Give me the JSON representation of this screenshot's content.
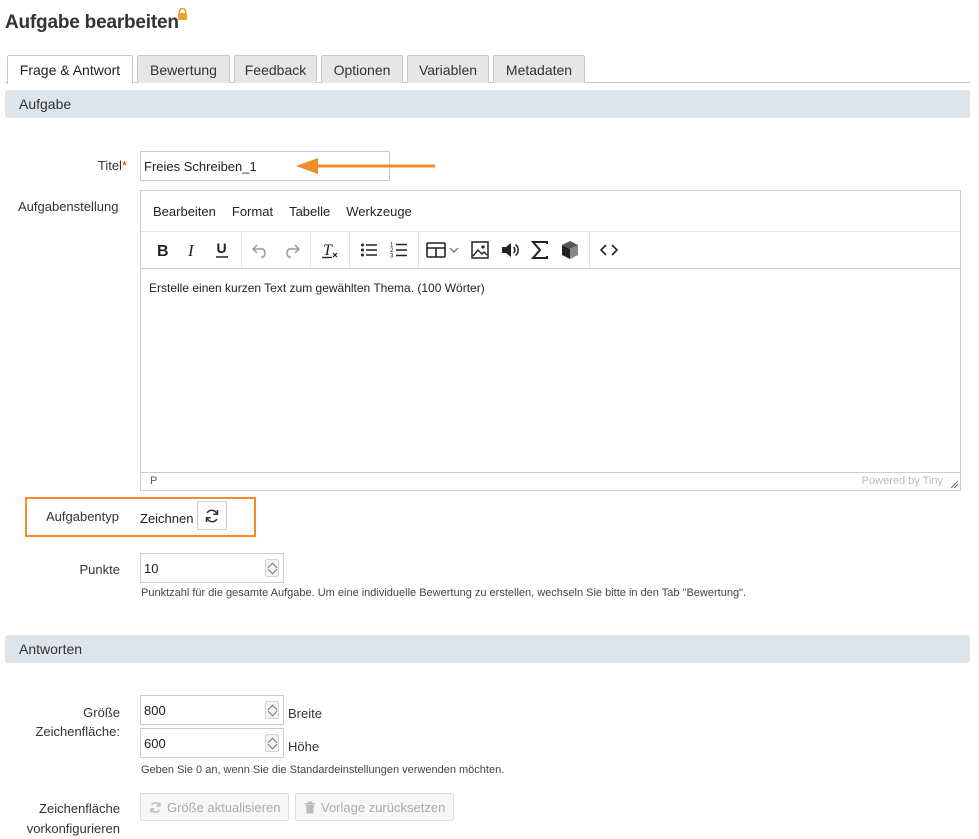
{
  "page": {
    "title": "Aufgabe bearbeiten"
  },
  "tabs": [
    {
      "label": "Frage & Antwort",
      "active": true
    },
    {
      "label": "Bewertung"
    },
    {
      "label": "Feedback"
    },
    {
      "label": "Optionen"
    },
    {
      "label": "Variablen"
    },
    {
      "label": "Metadaten"
    }
  ],
  "sections": {
    "aufgabe": "Aufgabe",
    "antworten": "Antworten"
  },
  "form": {
    "titel_label": "Titel",
    "titel_required": "*",
    "titel_value": "Freies Schreiben_1",
    "aufgabenstellung_label": "Aufgabenstellung",
    "aufgabentyp_label": "Aufgabentyp",
    "aufgabentyp_value": "Zeichnen",
    "punkte_label": "Punkte",
    "punkte_value": "10",
    "punkte_hint": "Punktzahl für die gesamte Aufgabe. Um eine individuelle Bewertung zu erstellen, wechseln Sie bitte in den Tab \"Bewertung\".",
    "groesse_label_1": "Größe",
    "groesse_label_2": "Zeichenfläche:",
    "breite_value": "800",
    "breite_label": "Breite",
    "hoehe_value": "600",
    "hoehe_label": "Höhe",
    "groesse_hint": "Geben Sie 0 an, wenn Sie die Standardeinstellungen verwenden möchten.",
    "vorkonfig_label_1": "Zeichenfläche",
    "vorkonfig_label_2": "vorkonfigurieren",
    "btn_groesse": "Größe aktualisieren",
    "btn_vorlage": "Vorlage zurücksetzen"
  },
  "editor": {
    "menu": [
      "Bearbeiten",
      "Format",
      "Tabelle",
      "Werkzeuge"
    ],
    "content": "Erstelle einen kurzen Text zum gewählten Thema. (100 Wörter)",
    "status_path": "P",
    "powered": "Powered by Tiny"
  },
  "colors": {
    "highlight": "#f28c28",
    "section_bg": "#dde4ea",
    "required": "#c03a00"
  }
}
